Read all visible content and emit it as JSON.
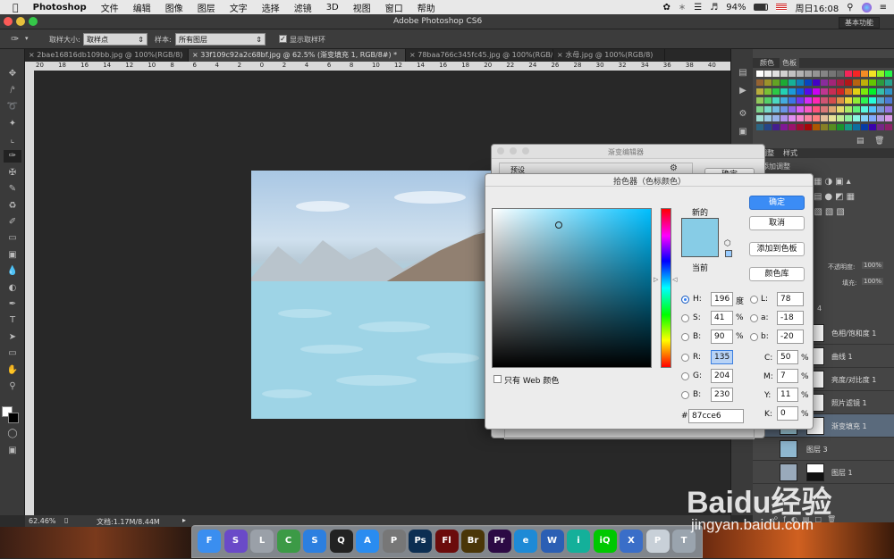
{
  "menubar": {
    "app_name": "Photoshop",
    "items": [
      "文件",
      "编辑",
      "图像",
      "图层",
      "文字",
      "选择",
      "滤镜",
      "3D",
      "视图",
      "窗口",
      "帮助"
    ],
    "battery": "94%",
    "clock": "周日16:08"
  },
  "window": {
    "title": "Adobe Photoshop CS6",
    "workspace": "基本功能"
  },
  "options_bar": {
    "sample_size_label": "取样大小:",
    "sample_size_value": "取样点",
    "sample_label": "样本:",
    "sample_value": "所有图层",
    "show_ring_label": "显示取样环"
  },
  "doc_tabs": [
    {
      "label": "2bae16816db109bb.jpg @ 100%(RGB/8)"
    },
    {
      "label": "33f109c92a2c68bf.jpg @ 62.5% (渐变填充 1, RGB/8#) *"
    },
    {
      "label": "78baa766c345fc45.jpg @ 100%(RGB/8)"
    },
    {
      "label": "水母.jpg @ 100%(RGB/8)"
    }
  ],
  "ruler_ticks": [
    "20",
    "18",
    "16",
    "14",
    "12",
    "10",
    "8",
    "6",
    "4",
    "2",
    "0",
    "2",
    "4",
    "6",
    "8",
    "10",
    "12",
    "14",
    "16",
    "18",
    "20",
    "22",
    "24",
    "26",
    "28",
    "30",
    "32",
    "34",
    "36",
    "38",
    "40"
  ],
  "status": {
    "zoom": "62.46%",
    "doc": "文档:1.17M/8.44M"
  },
  "gradient_editor": {
    "title": "渐变编辑器",
    "presets_label": "预设",
    "ok_label": "确定"
  },
  "color_picker": {
    "title": "拾色器（色标颜色）",
    "new_label": "新的",
    "current_label": "当前",
    "new_color": "#87cce6",
    "current_color": "#87cce6",
    "buttons": {
      "ok": "确定",
      "cancel": "取消",
      "add_swatch": "添加到色板",
      "libraries": "颜色库"
    },
    "web_only_label": "只有 Web 颜色",
    "hsb": [
      {
        "label": "H:",
        "value": "196",
        "unit": "度"
      },
      {
        "label": "S:",
        "value": "41",
        "unit": "%"
      },
      {
        "label": "B:",
        "value": "90",
        "unit": "%"
      }
    ],
    "rgb": [
      {
        "label": "R:",
        "value": "135"
      },
      {
        "label": "G:",
        "value": "204"
      },
      {
        "label": "B:",
        "value": "230"
      }
    ],
    "lab": [
      {
        "label": "L:",
        "value": "78"
      },
      {
        "label": "a:",
        "value": "-18"
      },
      {
        "label": "b:",
        "value": "-20"
      }
    ],
    "cmyk": [
      {
        "label": "C:",
        "value": "50",
        "unit": "%"
      },
      {
        "label": "M:",
        "value": "7",
        "unit": "%"
      },
      {
        "label": "Y:",
        "value": "11",
        "unit": "%"
      },
      {
        "label": "K:",
        "value": "0",
        "unit": "%"
      }
    ],
    "hex_label": "#",
    "hex": "87cce6"
  },
  "panels": {
    "color_tabs": [
      "颜色",
      "色板"
    ],
    "adjust_tabs": [
      "调整",
      "样式"
    ],
    "adjust_add_label": "添加调整",
    "opacity_label": "不透明度:",
    "opacity_value": "100%",
    "fill_label": "填充:",
    "fill_value": "100%",
    "group_label": "4",
    "layers": [
      {
        "name": "色相/饱和度 1"
      },
      {
        "name": "曲线 1"
      },
      {
        "name": "亮度/对比度 1"
      },
      {
        "name": "照片滤镜 1"
      },
      {
        "name": "渐变填充 1"
      },
      {
        "name": "图层 3"
      },
      {
        "name": "图层 1"
      }
    ]
  },
  "dock_apps": [
    {
      "name": "Finder",
      "short": "F",
      "color": "#3a8ef0"
    },
    {
      "name": "Siri",
      "short": "S",
      "color": "#6a4ac8"
    },
    {
      "name": "Launchpad",
      "short": "L",
      "color": "#9aa0a8"
    },
    {
      "name": "Chrome",
      "short": "C",
      "color": "#3c9a46"
    },
    {
      "name": "Safari",
      "short": "S",
      "color": "#2c7fe0"
    },
    {
      "name": "QQ",
      "short": "Q",
      "color": "#222222"
    },
    {
      "name": "App Store",
      "short": "A",
      "color": "#2a8cf0"
    },
    {
      "name": "System Preferences",
      "short": "P",
      "color": "#777777"
    },
    {
      "name": "Photoshop",
      "short": "Ps",
      "color": "#0c2e52"
    },
    {
      "name": "Flash",
      "short": "Fl",
      "color": "#6b0c0c"
    },
    {
      "name": "Bridge",
      "short": "Br",
      "color": "#4a3608"
    },
    {
      "name": "Premiere",
      "short": "Pr",
      "color": "#2c0a44"
    },
    {
      "name": "Browser",
      "short": "e",
      "color": "#1e8ad6"
    },
    {
      "name": "Word",
      "short": "W",
      "color": "#2b5fb4"
    },
    {
      "name": "iQiyi app",
      "short": "i",
      "color": "#14b09a"
    },
    {
      "name": "iQIYI",
      "short": "iQ",
      "color": "#00c800"
    },
    {
      "name": "Xcode",
      "short": "X",
      "color": "#3a6ec8"
    },
    {
      "name": "Preview",
      "short": "P",
      "color": "#c8d0d8"
    },
    {
      "name": "Trash",
      "short": "T",
      "color": "#9aa4ae"
    }
  ],
  "watermark": {
    "brand": "Baidu经验",
    "url": "jingyan.baidu.com"
  }
}
